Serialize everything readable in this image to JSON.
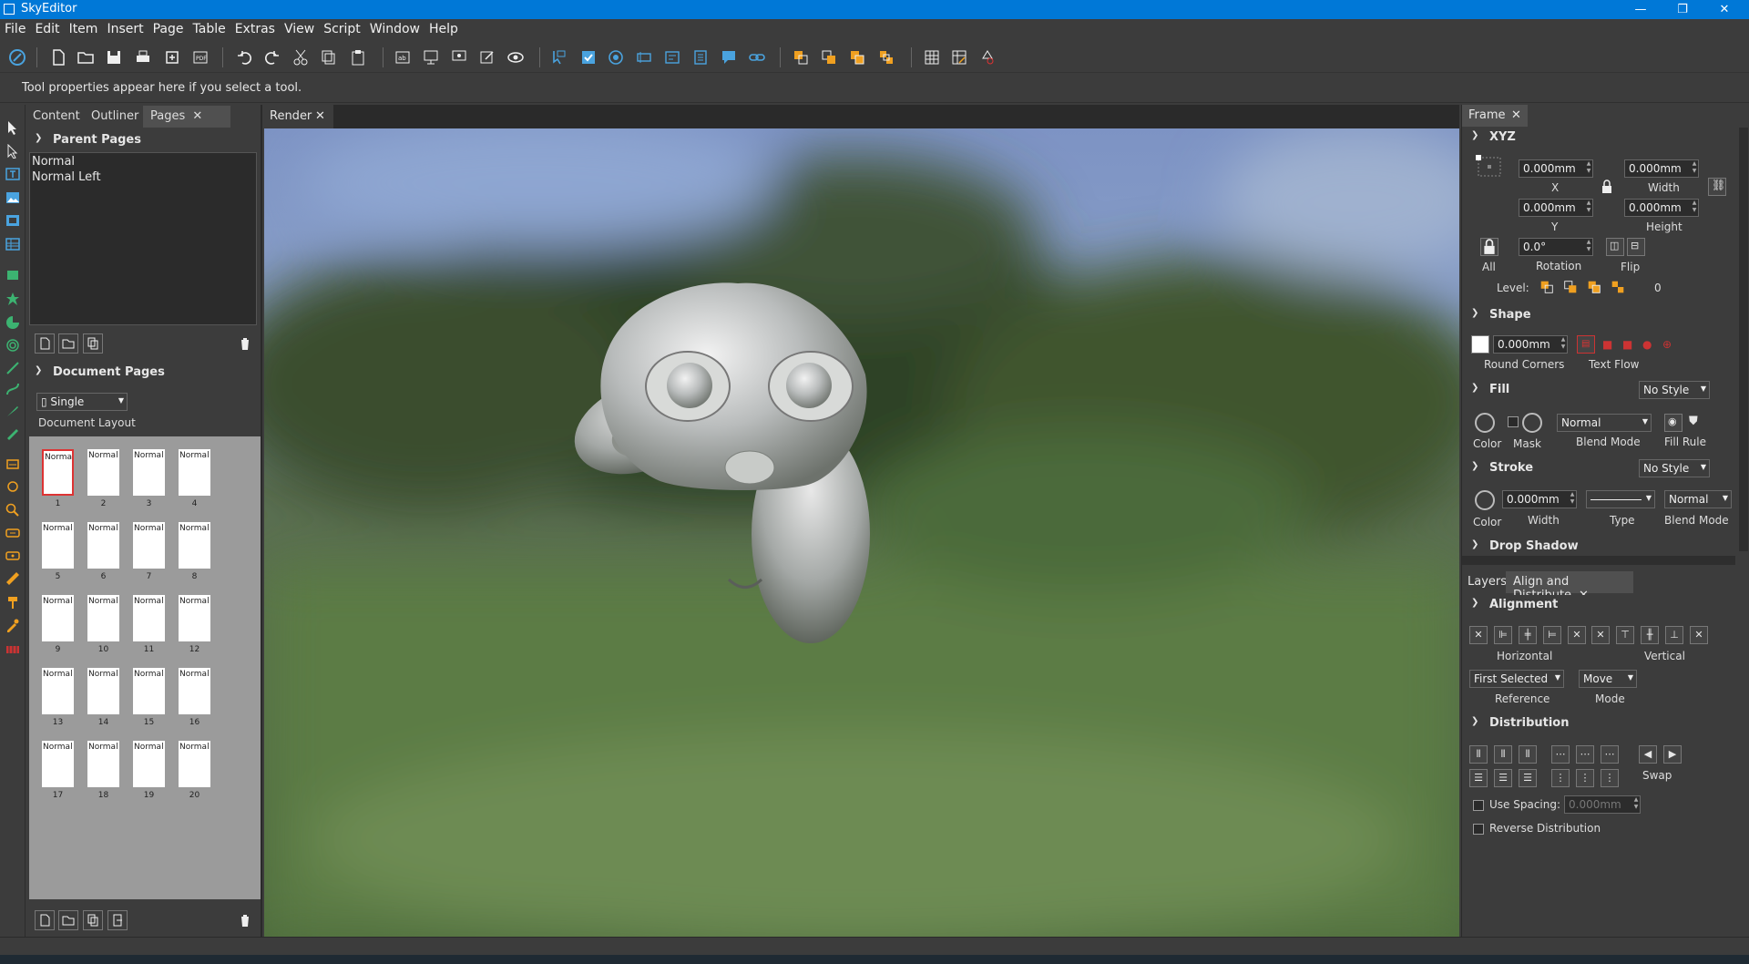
{
  "window": {
    "title": "SkyEditor",
    "minimize": "—",
    "maximize": "❐",
    "close": "✕"
  },
  "menu": [
    "File",
    "Edit",
    "Item",
    "Insert",
    "Page",
    "Table",
    "Extras",
    "View",
    "Script",
    "Window",
    "Help"
  ],
  "toolprops": {
    "text": "Tool properties appear here if you select a tool."
  },
  "left_panel": {
    "tabs": [
      "Content",
      "Outliner",
      "Pages"
    ],
    "parent_pages": {
      "title": "Parent Pages",
      "items": [
        "Normal",
        "Normal Left"
      ]
    },
    "document_pages": {
      "title": "Document Pages",
      "layout_value": "Single",
      "layout_label": "Document Layout",
      "thumb_text": "Normal",
      "pages": [
        "1",
        "2",
        "3",
        "4",
        "5",
        "6",
        "7",
        "8",
        "9",
        "10",
        "11",
        "12",
        "13",
        "14",
        "15",
        "16",
        "17",
        "18",
        "19",
        "20"
      ]
    }
  },
  "render_tab": {
    "label": "Render"
  },
  "right_panel": {
    "frame_tab": "Frame",
    "xyz": {
      "title": "XYZ",
      "x_value": "0.000mm",
      "x_label": "X",
      "y_value": "0.000mm",
      "y_label": "Y",
      "width_value": "0.000mm",
      "width_label": "Width",
      "height_value": "0.000mm",
      "height_label": "Height",
      "rotation_value": "0.0°",
      "rotation_label": "Rotation",
      "all_label": "All",
      "flip_label": "Flip",
      "level_label": "Level:",
      "level_value": "0"
    },
    "shape": {
      "title": "Shape",
      "corners_value": "0.000mm",
      "corners_label": "Round Corners",
      "textflow_label": "Text Flow"
    },
    "fill": {
      "title": "Fill",
      "style": "No Style",
      "color_label": "Color",
      "mask_label": "Mask",
      "blend_value": "Normal",
      "blend_label": "Blend Mode",
      "rule_label": "Fill Rule"
    },
    "stroke": {
      "title": "Stroke",
      "style": "No Style",
      "color_label": "Color",
      "width_value": "0.000mm",
      "width_label": "Width",
      "type_label": "Type",
      "blend_value": "Normal",
      "blend_label": "Blend Mode"
    },
    "dropshadow": {
      "title": "Drop Shadow"
    },
    "bottom_tabs": [
      "Layers",
      "Align and Distribute"
    ],
    "alignment": {
      "title": "Alignment",
      "horizontal_label": "Horizontal",
      "vertical_label": "Vertical",
      "reference_value": "First Selected",
      "reference_label": "Reference",
      "mode_value": "Move",
      "mode_label": "Mode"
    },
    "distribution": {
      "title": "Distribution",
      "swap_label": "Swap",
      "use_spacing_label": "Use Spacing:",
      "spacing_value": "0.000mm",
      "reverse_label": "Reverse Distribution"
    }
  },
  "colors": {
    "accent": "#0078d7",
    "panel": "#3c3c3c",
    "tool_blue": "#4aa3df",
    "tool_green": "#3cb371",
    "tool_orange": "#f0a020",
    "selection": "#dd3333"
  }
}
